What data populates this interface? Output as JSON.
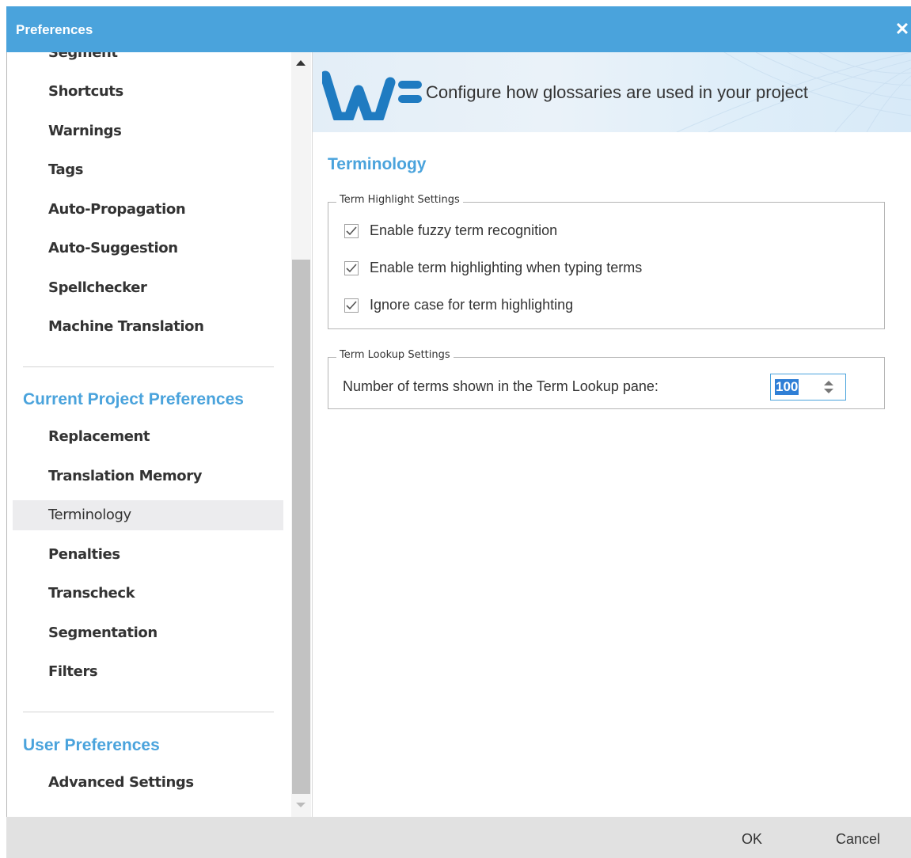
{
  "window": {
    "title": "Preferences"
  },
  "sidebar": {
    "global_items": [
      {
        "label": "Segment"
      },
      {
        "label": "Shortcuts"
      },
      {
        "label": "Warnings"
      },
      {
        "label": "Tags"
      },
      {
        "label": "Auto-Propagation"
      },
      {
        "label": "Auto-Suggestion"
      },
      {
        "label": "Spellchecker"
      },
      {
        "label": "Machine Translation"
      }
    ],
    "project_heading": "Current Project Preferences",
    "project_items": [
      {
        "label": "Replacement"
      },
      {
        "label": "Translation Memory"
      },
      {
        "label": "Terminology",
        "selected": true
      },
      {
        "label": "Penalties"
      },
      {
        "label": "Transcheck"
      },
      {
        "label": "Segmentation"
      },
      {
        "label": "Filters"
      }
    ],
    "user_heading": "User Preferences",
    "user_items": [
      {
        "label": "Advanced Settings"
      }
    ]
  },
  "banner": {
    "logo": "WF",
    "text": "Configure how glossaries are used in your project"
  },
  "main": {
    "title": "Terminology",
    "highlight_group": {
      "label": "Term Highlight Settings",
      "options": [
        {
          "label": "Enable fuzzy term recognition",
          "checked": true
        },
        {
          "label": "Enable term highlighting when typing terms",
          "checked": true
        },
        {
          "label": "Ignore case for term highlighting",
          "checked": true
        }
      ]
    },
    "lookup_group": {
      "label": "Term Lookup Settings",
      "field_label": "Number of terms shown in the Term Lookup pane:",
      "value": "100"
    }
  },
  "footer": {
    "ok_label": "OK",
    "cancel_label": "Cancel"
  },
  "colors": {
    "accent": "#4aa3dc",
    "logo": "#1f7bc1",
    "selected_bg": "#ececee"
  }
}
